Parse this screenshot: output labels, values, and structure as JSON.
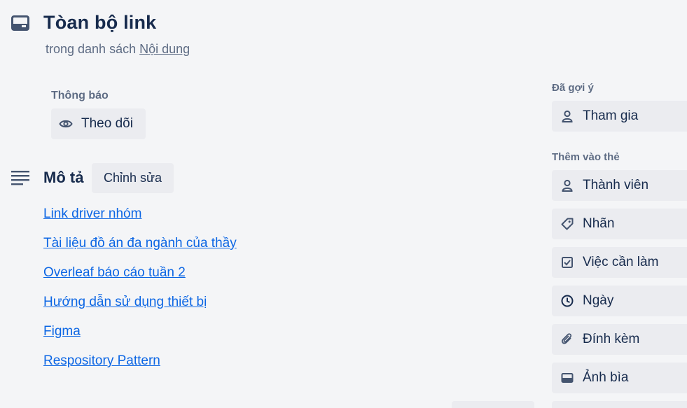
{
  "card": {
    "title": "Tòan bộ link",
    "subtitle_prefix": "trong danh sách",
    "list_name": "Nội dung"
  },
  "notifications": {
    "label": "Thông báo",
    "watch_label": "Theo dõi"
  },
  "description": {
    "title": "Mô tả",
    "edit_label": "Chỉnh sửa",
    "links": [
      "Link driver nhóm",
      "Tài liệu đồ án đa ngành của thầy",
      "Overleaf báo cáo tuần 2",
      "Hướng dẫn sử dụng thiết bị",
      "Figma",
      "Respository Pattern"
    ]
  },
  "sidebar": {
    "suggested_label": "Đã gợi ý",
    "join_label": "Tham gia",
    "add_to_card_label": "Thêm vào thẻ",
    "items": [
      {
        "label": "Thành viên",
        "icon": "member-icon"
      },
      {
        "label": "Nhãn",
        "icon": "label-icon"
      },
      {
        "label": "Việc cần làm",
        "icon": "checklist-icon"
      },
      {
        "label": "Ngày",
        "icon": "clock-icon"
      },
      {
        "label": "Đính kèm",
        "icon": "attachment-icon"
      },
      {
        "label": "Ảnh bìa",
        "icon": "cover-icon"
      }
    ]
  },
  "colors": {
    "background": "#f4f5f7",
    "button": "#ebecf0",
    "link": "#0c66e4",
    "text": "#172b4d",
    "muted": "#5e6c84"
  }
}
